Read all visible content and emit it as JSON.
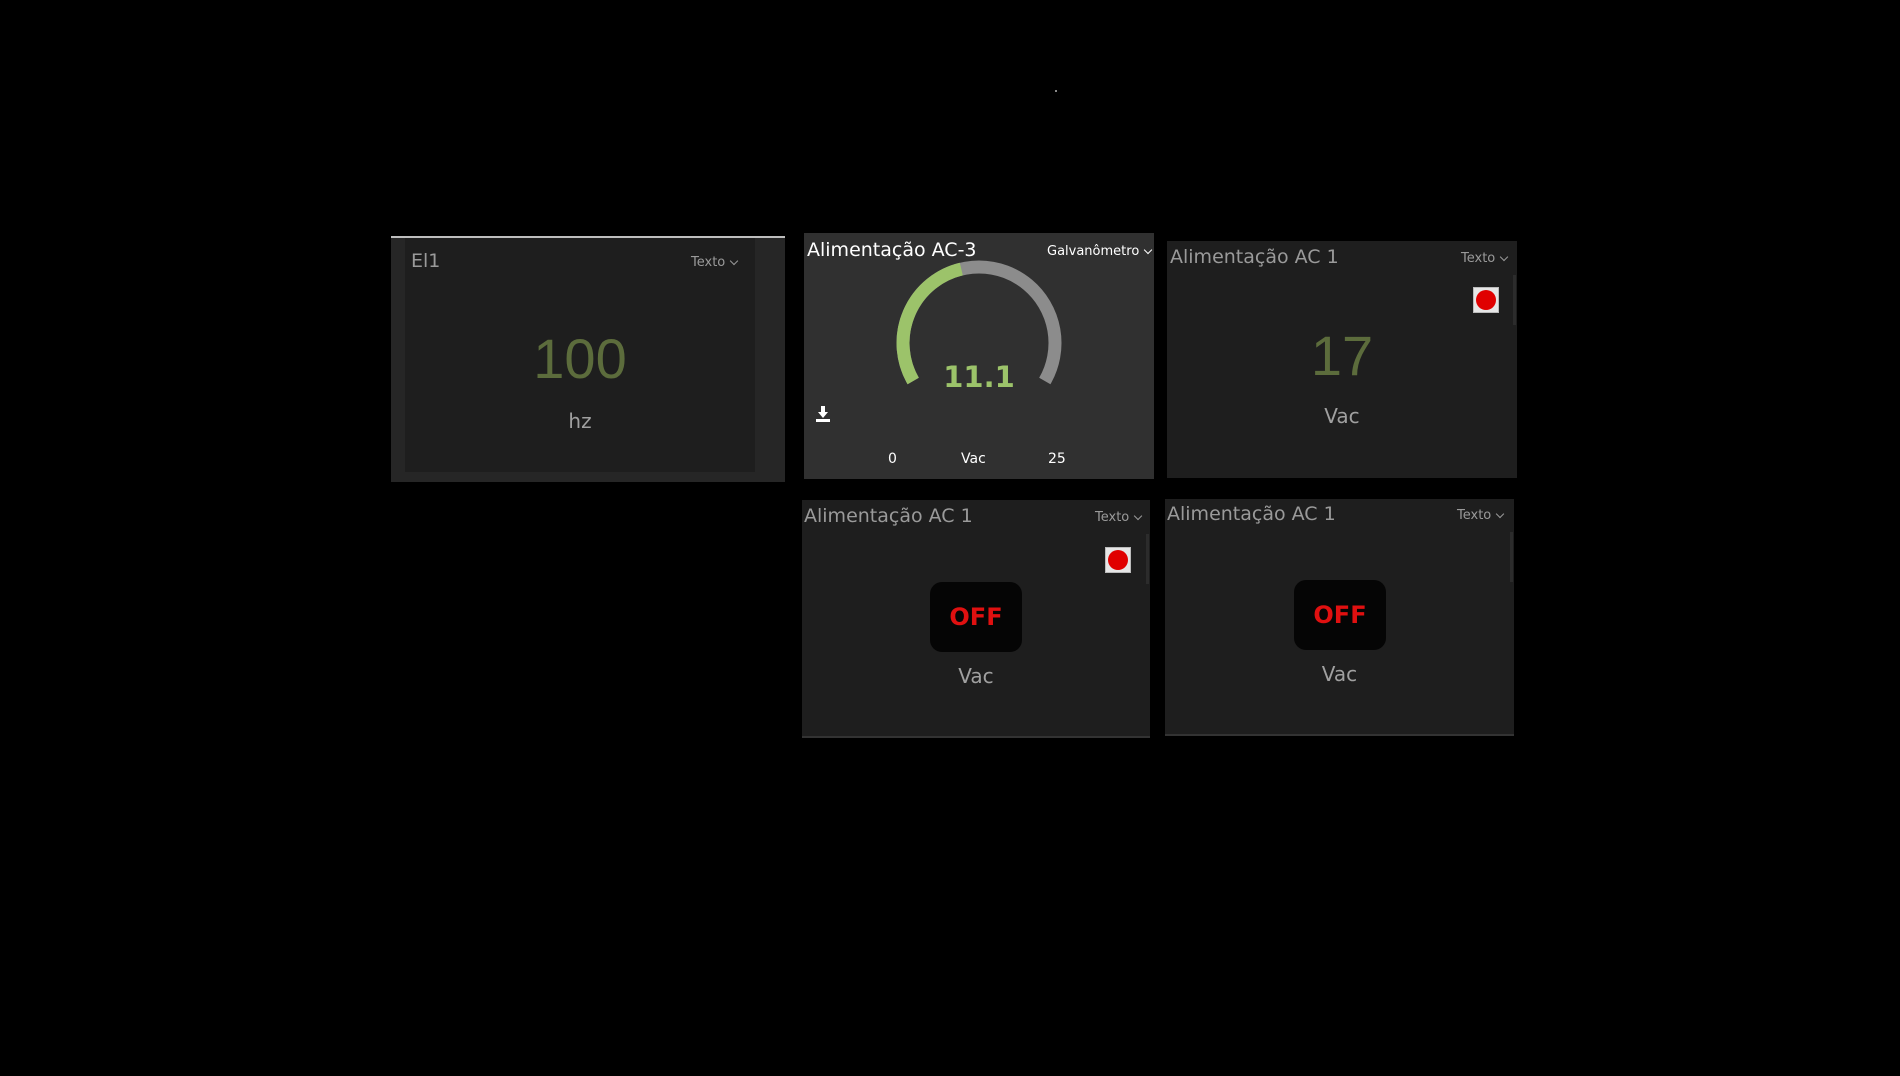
{
  "widgets": {
    "el1": {
      "title": "El1",
      "view": "Texto",
      "value": "100",
      "unit": "hz"
    },
    "gauge": {
      "title": "Alimentação AC-3",
      "view": "Galvanômetro",
      "value": "11.1",
      "min": "0",
      "max": "25",
      "unit": "Vac",
      "fill_fraction": 0.444,
      "fill_color": "#9cc36a",
      "track_color": "#8c8c8c"
    },
    "ac1_text": {
      "title": "Alimentação AC 1",
      "view": "Texto",
      "value": "17",
      "unit": "Vac"
    },
    "ac1_off_a": {
      "title": "Alimentação AC 1",
      "view": "Texto",
      "state": "OFF",
      "unit": "Vac"
    },
    "ac1_off_b": {
      "title": "Alimentação AC 1",
      "view": "Texto",
      "state": "OFF",
      "unit": "Vac"
    }
  },
  "colors": {
    "background": "#000000",
    "panel": "#1e1e1e",
    "value_text": "#5c6c3c",
    "alarm": "#e00000",
    "off_text": "#e01010"
  },
  "icons": {
    "alarm": "red-circle-alarm-icon",
    "download": "download-icon",
    "dropdown": "chevron-down-icon"
  }
}
